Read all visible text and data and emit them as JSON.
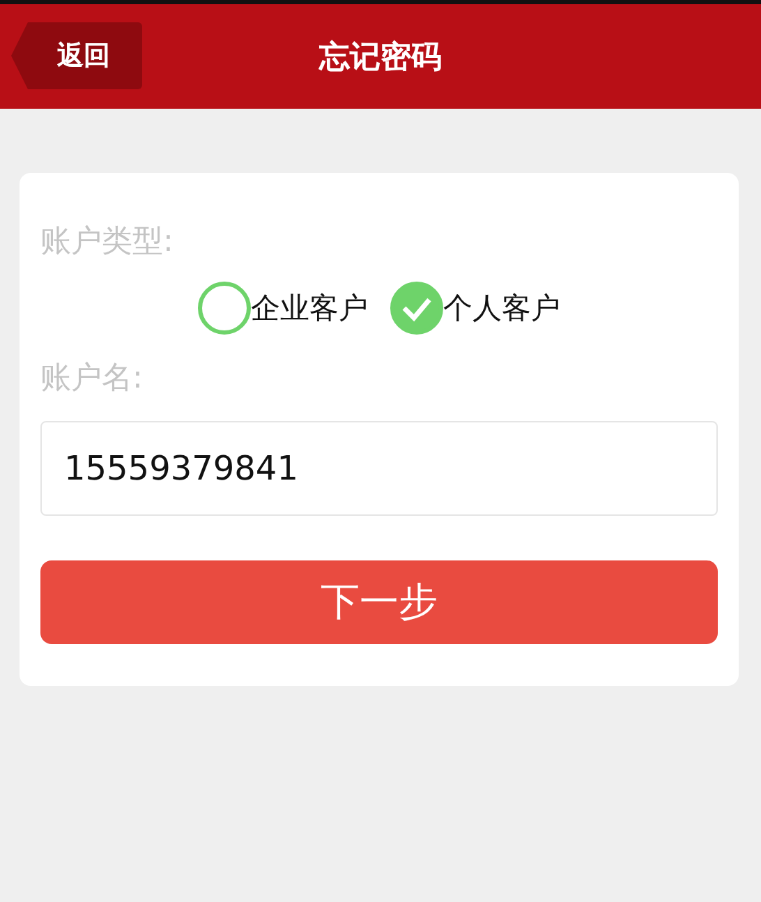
{
  "header": {
    "back_button": "返回",
    "title": "忘记密码"
  },
  "form": {
    "account_type_label": "账户类型:",
    "account_types": [
      {
        "label": "企业客户",
        "selected": false
      },
      {
        "label": "个人客户",
        "selected": true
      }
    ],
    "account_name_label": "账户名:",
    "account_name": {
      "value": "15559379841"
    },
    "next_button": "下一步"
  }
}
